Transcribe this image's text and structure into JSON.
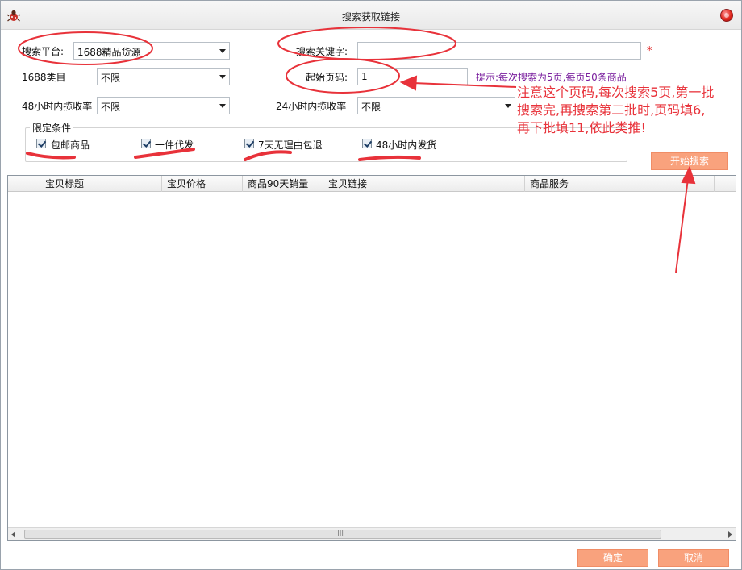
{
  "window": {
    "title": "搜索获取链接"
  },
  "form": {
    "platform_label": "搜索平台:",
    "platform_value": "1688精品货源",
    "keyword_label": "搜索关键字:",
    "keyword_value": "",
    "required_mark": "*",
    "category_label": "1688类目",
    "category_value": "不限",
    "start_page_label": "起始页码:",
    "start_page_value": "1",
    "hint": "提示:每次搜索为5页,每页50条商品",
    "rate48_label": "48小时内揽收率",
    "rate48_value": "不限",
    "rate24_label": "24小时内揽收率",
    "rate24_value": "不限"
  },
  "conditions": {
    "title": "限定条件",
    "items": [
      {
        "label": "包邮商品",
        "checked": true
      },
      {
        "label": "一件代发",
        "checked": true
      },
      {
        "label": "7天无理由包退",
        "checked": true
      },
      {
        "label": "48小时内发货",
        "checked": true
      }
    ]
  },
  "buttons": {
    "start_search": "开始搜索",
    "ok": "确定",
    "cancel": "取消"
  },
  "grid": {
    "columns": [
      "",
      "宝贝标题",
      "宝贝价格",
      "商品90天销量",
      "宝贝链接",
      "商品服务"
    ],
    "scroll_grip": "|||"
  },
  "annotation": {
    "lines": [
      "注意这个页码,每次搜索5页,第一批",
      "搜索完,再搜索第二批时,页码填6,",
      "再下批填11,依此类推!"
    ],
    "color": "#e8323a"
  }
}
